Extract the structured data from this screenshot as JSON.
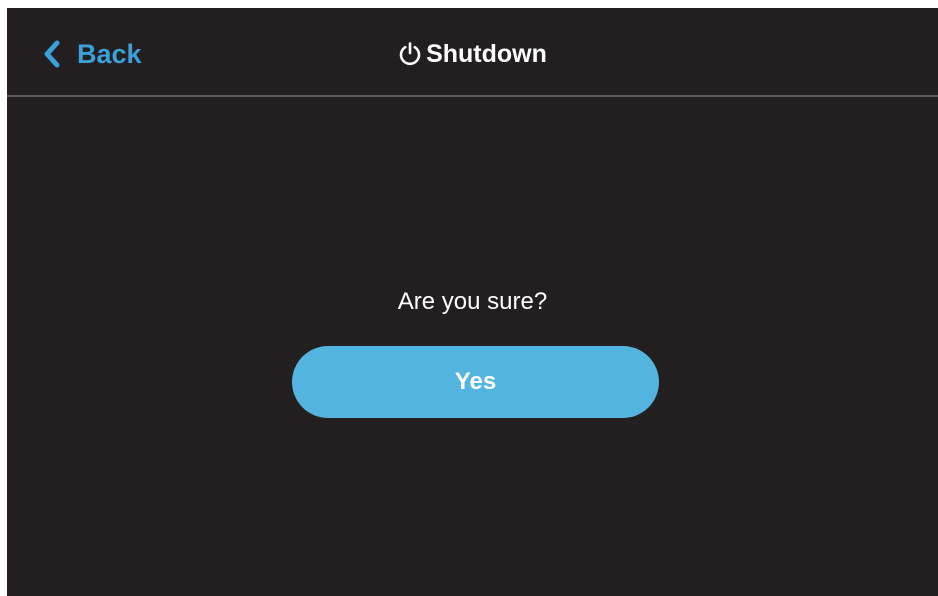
{
  "header": {
    "back_label": "Back",
    "title": "Shutdown",
    "back_icon": "chevron-left-icon",
    "title_icon": "power-icon"
  },
  "dialog": {
    "prompt": "Are you sure?",
    "confirm_label": "Yes"
  },
  "colors": {
    "background": "#231f20",
    "accent": "#3aa0d8",
    "button": "#53b5df",
    "divider": "#5a5a5a",
    "text": "#ffffff"
  }
}
